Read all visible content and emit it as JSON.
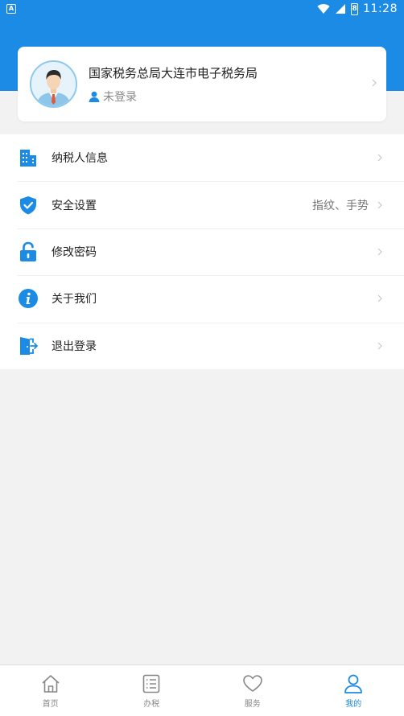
{
  "status_bar": {
    "time": "11:28",
    "battery_level": "8"
  },
  "profile": {
    "org_name": "国家税务总局大连市电子税务局",
    "login_status": "未登录"
  },
  "menu": {
    "items": [
      {
        "label": "纳税人信息",
        "value": "",
        "icon": "building-icon"
      },
      {
        "label": "安全设置",
        "value": "指纹、手势",
        "icon": "shield-check-icon"
      },
      {
        "label": "修改密码",
        "value": "",
        "icon": "unlock-icon"
      },
      {
        "label": "关于我们",
        "value": "",
        "icon": "info-icon"
      },
      {
        "label": "退出登录",
        "value": "",
        "icon": "exit-door-icon"
      }
    ]
  },
  "tabbar": {
    "tabs": [
      {
        "label": "首页",
        "icon": "home-icon"
      },
      {
        "label": "办税",
        "icon": "list-icon"
      },
      {
        "label": "服务",
        "icon": "heart-icon"
      },
      {
        "label": "我的",
        "icon": "person-icon"
      }
    ],
    "active": "我的"
  },
  "colors": {
    "accent": "#1c8be6",
    "background": "#f2f2f2"
  }
}
